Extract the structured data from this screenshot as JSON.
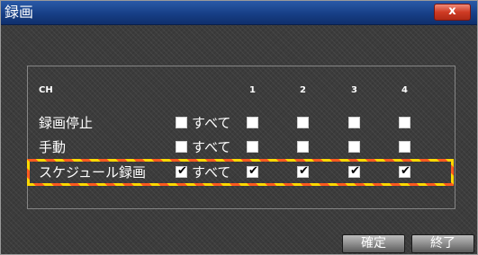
{
  "window": {
    "title": "録画",
    "close_label": "x"
  },
  "table": {
    "ch_header": "CH",
    "channels": [
      "1",
      "2",
      "3",
      "4"
    ],
    "all_label": "すべて",
    "rows": [
      {
        "label": "録画停止",
        "all_checked": false,
        "channels_checked": [
          false,
          false,
          false,
          false
        ]
      },
      {
        "label": "手動",
        "all_checked": false,
        "channels_checked": [
          false,
          false,
          false,
          false
        ]
      },
      {
        "label": "スケジュール録画",
        "all_checked": true,
        "channels_checked": [
          true,
          true,
          true,
          true
        ]
      }
    ]
  },
  "buttons": {
    "ok_label": "確定",
    "close_label": "終了"
  },
  "colors": {
    "titlebar": "#173f86",
    "highlight_yellow": "#ffd800",
    "highlight_orange": "#ff5a1f",
    "close_red": "#cf3b24"
  }
}
